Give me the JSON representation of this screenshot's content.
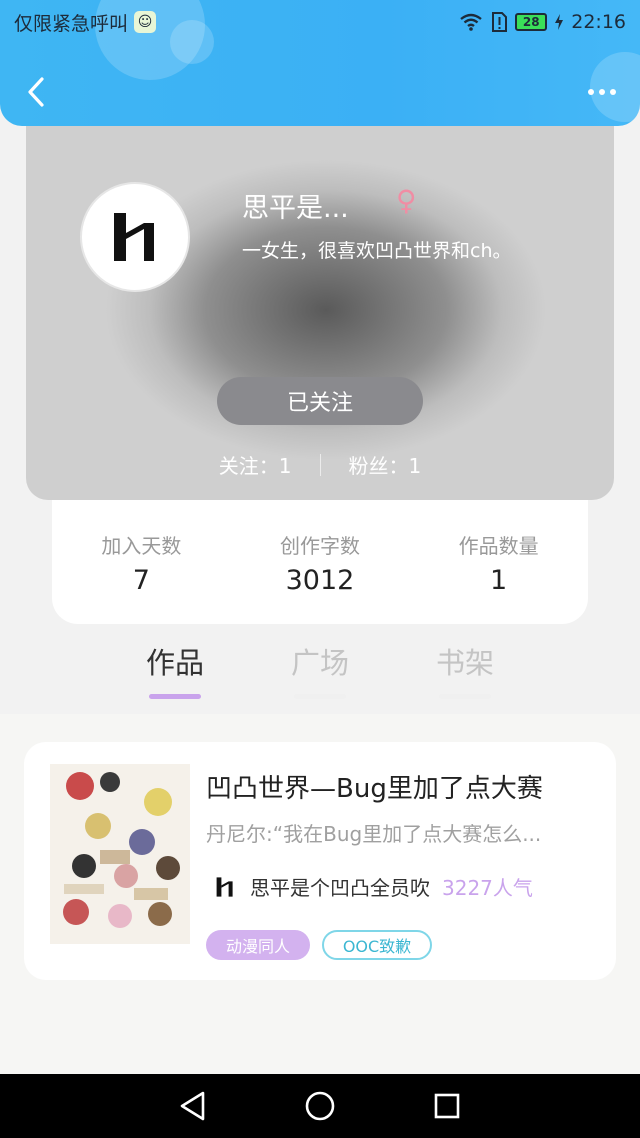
{
  "status_bar": {
    "carrier_text": "仅限紧急呼叫",
    "battery": "28",
    "time": "22:16"
  },
  "header": {
    "back_icon": "chevron-left-icon",
    "more_icon": "more-horizontal-icon"
  },
  "profile": {
    "username": "思平是...",
    "gender_symbol": "♀",
    "bio": "一女生，很喜欢凹凸世界和ch。",
    "follow_button_label": "已关注",
    "following": "关注：1",
    "followers": "粉丝：1"
  },
  "stats": [
    {
      "label": "加入天数",
      "value": "7"
    },
    {
      "label": "创作字数",
      "value": "3012"
    },
    {
      "label": "作品数量",
      "value": "1"
    }
  ],
  "tabs": [
    {
      "label": "作品",
      "active": true
    },
    {
      "label": "广场",
      "active": false
    },
    {
      "label": "书架",
      "active": false
    }
  ],
  "work": {
    "title": "凹凸世界—Bug里加了点大赛",
    "description": "丹尼尔:“我在Bug里加了点大赛怎么...",
    "author": "思平是个凹凸全员吹",
    "popularity": "3227人气",
    "tags": [
      "动漫同人",
      "OOC致歉"
    ]
  },
  "colors": {
    "header_blue": "#3fb6f3",
    "accent_purple": "#c9a3ec",
    "tag_cyan": "#3cb7d2"
  }
}
